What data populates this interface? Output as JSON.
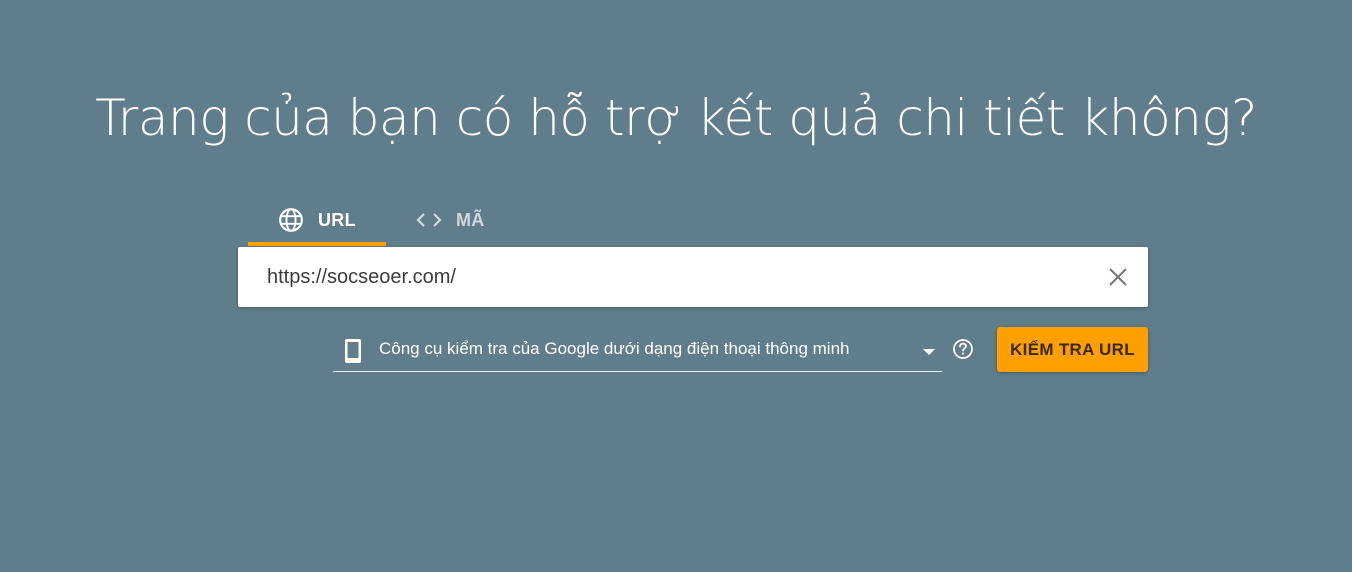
{
  "header": {
    "title": "Trang của bạn có hỗ trợ kết quả chi tiết không?"
  },
  "tabs": [
    {
      "label": "URL",
      "icon": "globe-icon",
      "active": true
    },
    {
      "label": "MÃ",
      "icon": "code-icon",
      "active": false
    }
  ],
  "url_input": {
    "value": "https://socseoer.com/"
  },
  "device_select": {
    "selected": "Công cụ kiểm tra của Google dưới dạng điện thoại thông minh",
    "icon": "smartphone-icon"
  },
  "test_button": {
    "label": "KIỂM TRA URL"
  },
  "colors": {
    "background": "#607d8b",
    "accent": "#ff9f00",
    "text_light": "#ffffff",
    "tab_inactive": "#cfd8dc"
  }
}
